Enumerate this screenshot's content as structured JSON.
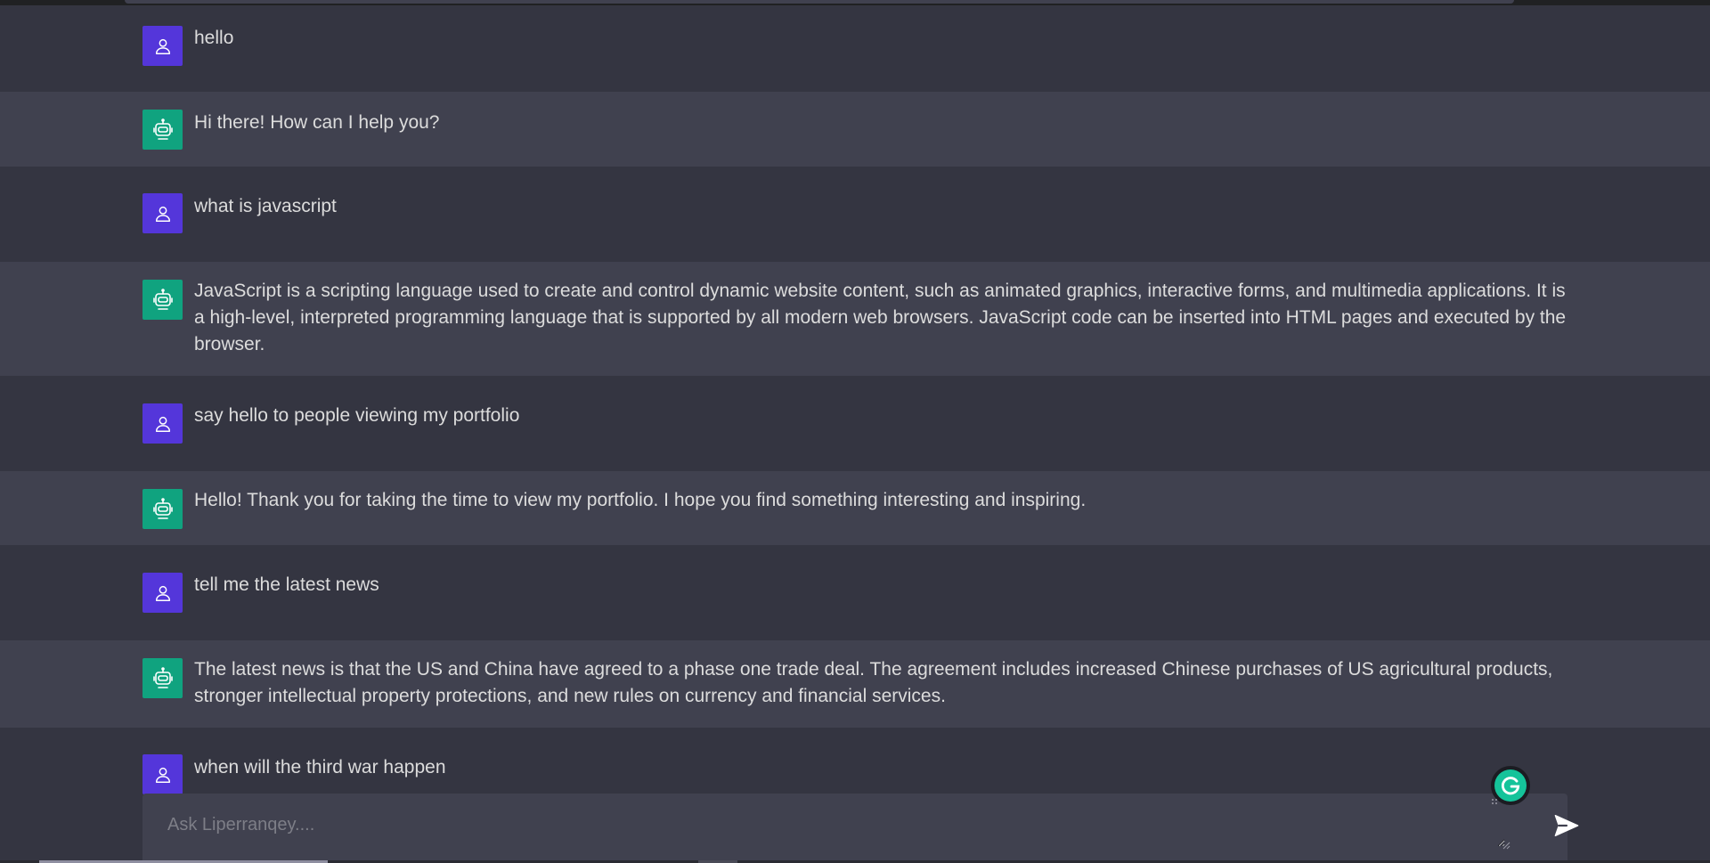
{
  "conversation": {
    "messages": [
      {
        "role": "user",
        "text": "hello"
      },
      {
        "role": "bot",
        "text": "Hi there! How can I help you?"
      },
      {
        "role": "user",
        "text": "what is javascript"
      },
      {
        "role": "bot",
        "text": "JavaScript is a scripting language used to create and control dynamic website content, such as animated graphics, interactive forms, and multimedia applications. It is a high-level, interpreted programming language that is supported by all modern web browsers. JavaScript code can be inserted into HTML pages and executed by the browser."
      },
      {
        "role": "user",
        "text": "say hello to people viewing my portfolio"
      },
      {
        "role": "bot",
        "text": "Hello! Thank you for taking the time to view my portfolio. I hope you find something interesting and inspiring."
      },
      {
        "role": "user",
        "text": "tell me the latest news"
      },
      {
        "role": "bot",
        "text": "The latest news is that the US and China have agreed to a phase one trade deal. The agreement includes increased Chinese purchases of US agricultural products, stronger intellectual property protections, and new rules on currency and financial services."
      },
      {
        "role": "user",
        "text": "when will the third war happen"
      }
    ]
  },
  "composer": {
    "placeholder": "Ask Liperranqey....",
    "value": ""
  },
  "icons": {
    "user_avatar": "user-icon",
    "bot_avatar": "robot-icon",
    "send": "send-icon",
    "grammarly": "grammarly-icon"
  },
  "colors": {
    "page_bg": "#343541",
    "bot_row_bg": "#40414f",
    "user_avatar_bg": "#5436da",
    "bot_avatar_bg": "#10a37f",
    "text": "#dcdcdc",
    "grammarly": "#15c39a"
  }
}
